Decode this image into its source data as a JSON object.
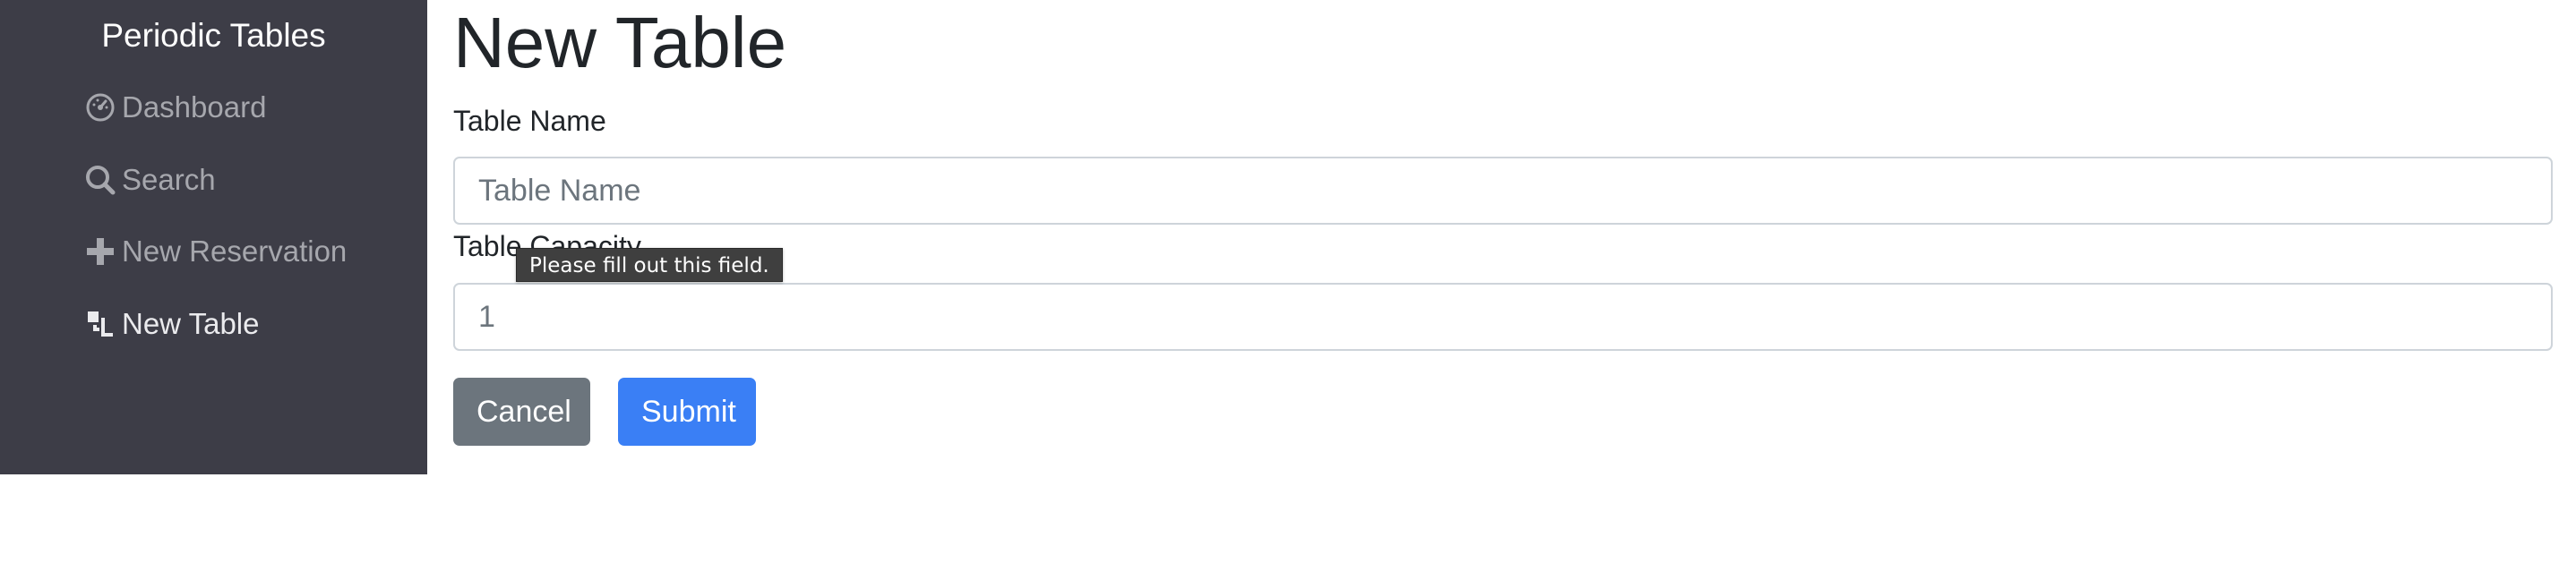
{
  "app": {
    "brand": "Periodic Tables"
  },
  "sidebar": {
    "items": [
      {
        "label": "Dashboard",
        "icon": "dashboard-icon"
      },
      {
        "label": "Search",
        "icon": "search-icon"
      },
      {
        "label": "New Reservation",
        "icon": "plus-icon"
      },
      {
        "label": "New Table",
        "icon": "table-icon",
        "active": true
      }
    ]
  },
  "main": {
    "title": "New Table",
    "table_name": {
      "label": "Table Name",
      "placeholder": "Table Name",
      "value": ""
    },
    "table_capacity": {
      "label": "Table Capacity",
      "value": "1"
    },
    "tooltip": "Please fill out this field.",
    "buttons": {
      "cancel": "Cancel",
      "submit": "Submit"
    }
  },
  "colors": {
    "sidebar_bg": "#3d3d47",
    "nav_text": "#a6a7ad",
    "nav_active": "#ebebee",
    "cancel_bg": "#6c757d",
    "submit_bg": "#3a7ff5"
  }
}
